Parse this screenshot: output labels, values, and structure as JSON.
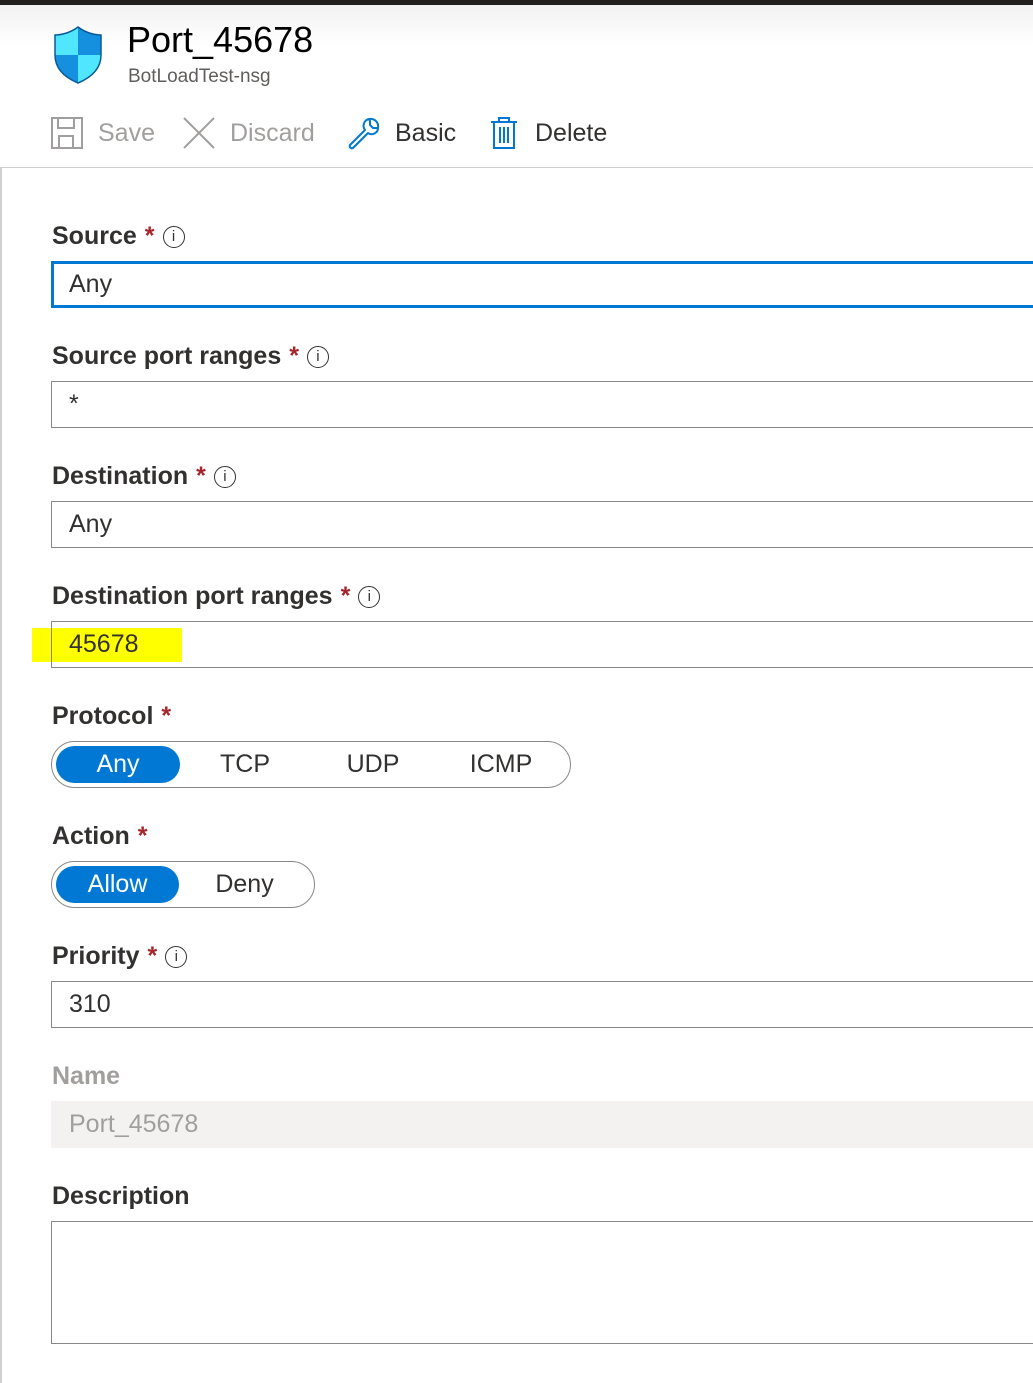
{
  "header": {
    "title": "Port_45678",
    "subtitle": "BotLoadTest-nsg",
    "icon": "shield-icon"
  },
  "toolbar": {
    "save_label": "Save",
    "discard_label": "Discard",
    "basic_label": "Basic",
    "delete_label": "Delete"
  },
  "form": {
    "source": {
      "label": "Source",
      "required": "*",
      "info": "i",
      "value": "Any"
    },
    "source_port_ranges": {
      "label": "Source port ranges",
      "required": "*",
      "info": "i",
      "value": "*"
    },
    "destination": {
      "label": "Destination",
      "required": "*",
      "info": "i",
      "value": "Any"
    },
    "destination_port_ranges": {
      "label": "Destination port ranges",
      "required": "*",
      "info": "i",
      "value": "45678"
    },
    "protocol": {
      "label": "Protocol",
      "required": "*",
      "options": [
        "Any",
        "TCP",
        "UDP",
        "ICMP"
      ],
      "selected": "Any"
    },
    "action": {
      "label": "Action",
      "required": "*",
      "options": [
        "Allow",
        "Deny"
      ],
      "selected": "Allow"
    },
    "priority": {
      "label": "Priority",
      "required": "*",
      "info": "i",
      "value": "310"
    },
    "name": {
      "label": "Name",
      "value": "Port_45678"
    },
    "description": {
      "label": "Description",
      "value": ""
    }
  },
  "colors": {
    "accent": "#0078d4",
    "required": "#a4262c",
    "highlight": "#ffff00"
  }
}
